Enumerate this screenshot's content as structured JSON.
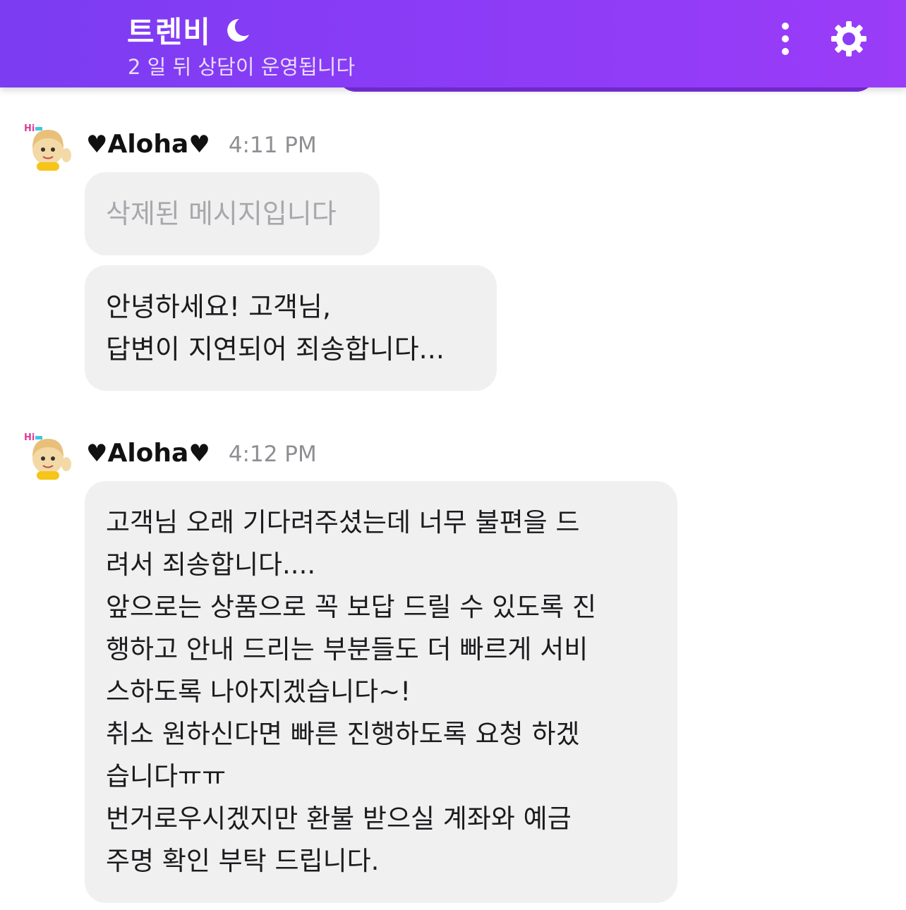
{
  "header": {
    "title": "트렌비",
    "subtitle": "2 일 뒤 상담이 운영됩니다",
    "icons": [
      "moon-icon",
      "more-vertical-icon",
      "gear-icon"
    ],
    "colors": {
      "gradient_start": "#7b3cf2",
      "gradient_end": "#9a3cf8"
    }
  },
  "messages": [
    {
      "sender": "♥Aloha♥",
      "sender_heart": "♥",
      "sender_name": "Aloha",
      "time": "4:11 PM",
      "bubbles": [
        {
          "type": "deleted",
          "lines": [
            "삭제된 메시지입니다"
          ]
        },
        {
          "type": "text",
          "lines": [
            "안녕하세요! 고객님,",
            "답변이 지연되어 죄송합니다..."
          ]
        }
      ]
    },
    {
      "sender": "♥Aloha♥",
      "sender_heart": "♥",
      "sender_name": "Aloha",
      "time": "4:12 PM",
      "bubbles": [
        {
          "type": "text",
          "lines": [
            "고객님 오래 기다려주셨는데 너무 불편을 드",
            "려서 죄송합니다....",
            "앞으로는 상품으로 꼭 보답 드릴 수 있도록 진",
            "행하고 안내 드리는 부분들도 더 빠르게 서비",
            "스하도록 나아지겠습니다~!",
            "취소 원하신다면 빠른 진행하도록 요청 하겠",
            "습니다ㅠㅠ",
            "번거로우시겠지만 환불 받으실 계좌와 예금",
            "주명 확인 부탁 드립니다."
          ]
        }
      ]
    }
  ],
  "colors": {
    "bubble_bg": "#f0f0f1",
    "deleted_text": "#a7a7ac",
    "time_text": "#8e8e93"
  }
}
